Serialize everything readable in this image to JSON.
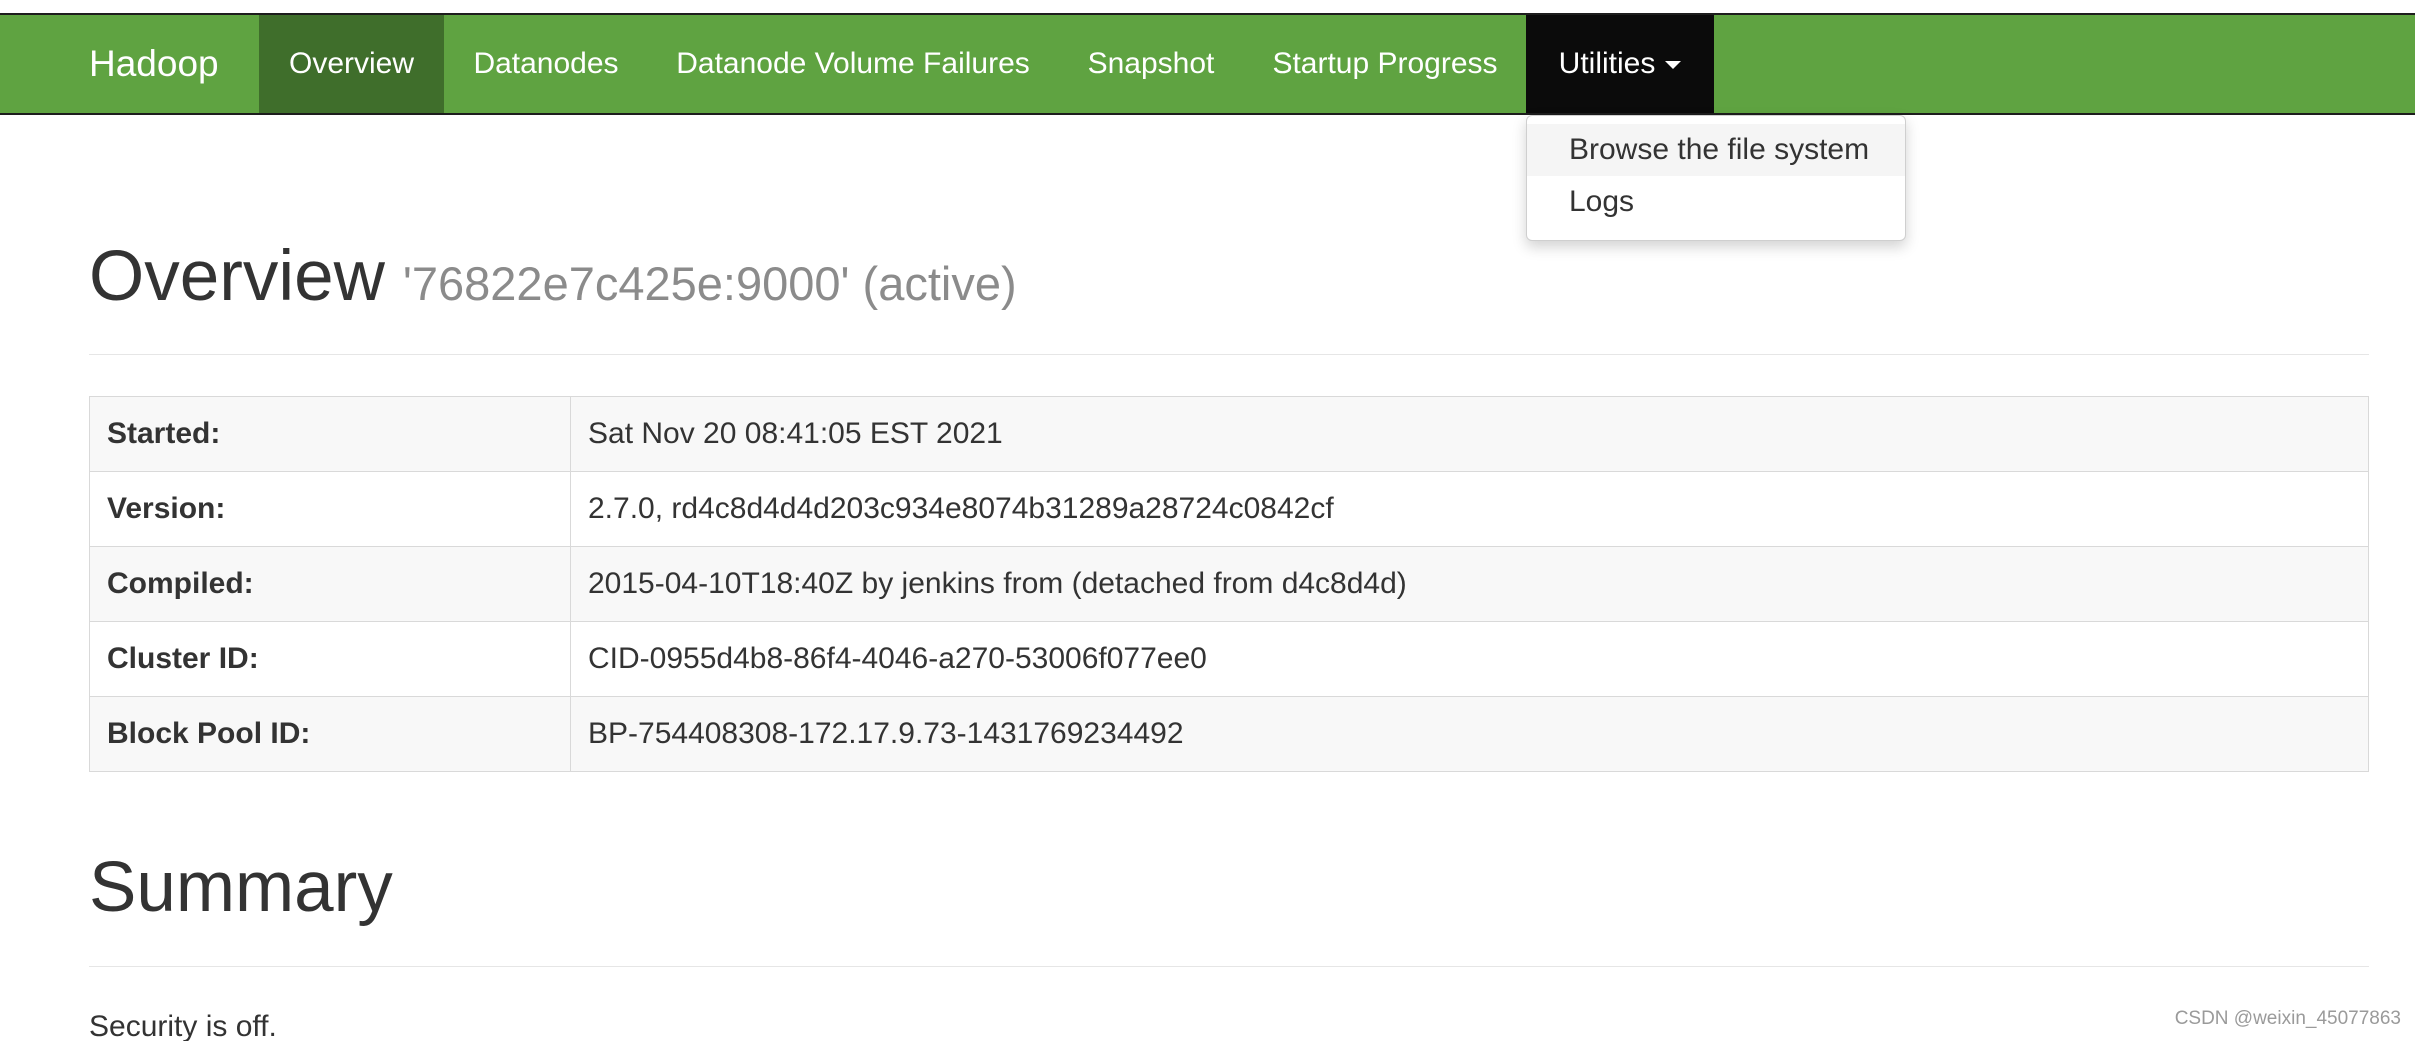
{
  "navbar": {
    "brand": "Hadoop",
    "items": [
      {
        "label": "Overview"
      },
      {
        "label": "Datanodes"
      },
      {
        "label": "Datanode Volume Failures"
      },
      {
        "label": "Snapshot"
      },
      {
        "label": "Startup Progress"
      },
      {
        "label": "Utilities"
      }
    ],
    "active_item": "Overview",
    "open_item": "Utilities",
    "bg_color": "#5fa341",
    "active_color": "#3f6e2b",
    "open_color": "#0b0b0b"
  },
  "utilities_dropdown": {
    "items": [
      {
        "label": "Browse the file system"
      },
      {
        "label": "Logs"
      }
    ],
    "hovered_item": "Browse the file system"
  },
  "overview": {
    "title": "Overview",
    "subtitle": "'76822e7c425e:9000' (active)",
    "rows": [
      {
        "key": "Started:",
        "value": "Sat Nov 20 08:41:05 EST 2021"
      },
      {
        "key": "Version:",
        "value": "2.7.0, rd4c8d4d4d203c934e8074b31289a28724c0842cf"
      },
      {
        "key": "Compiled:",
        "value": "2015-04-10T18:40Z by jenkins from (detached from d4c8d4d)"
      },
      {
        "key": "Cluster ID:",
        "value": "CID-0955d4b8-86f4-4046-a270-53006f077ee0"
      },
      {
        "key": "Block Pool ID:",
        "value": "BP-754408308-172.17.9.73-1431769234492"
      }
    ]
  },
  "summary": {
    "title": "Summary",
    "security_text": "Security is off."
  },
  "watermark": "CSDN @weixin_45077863"
}
